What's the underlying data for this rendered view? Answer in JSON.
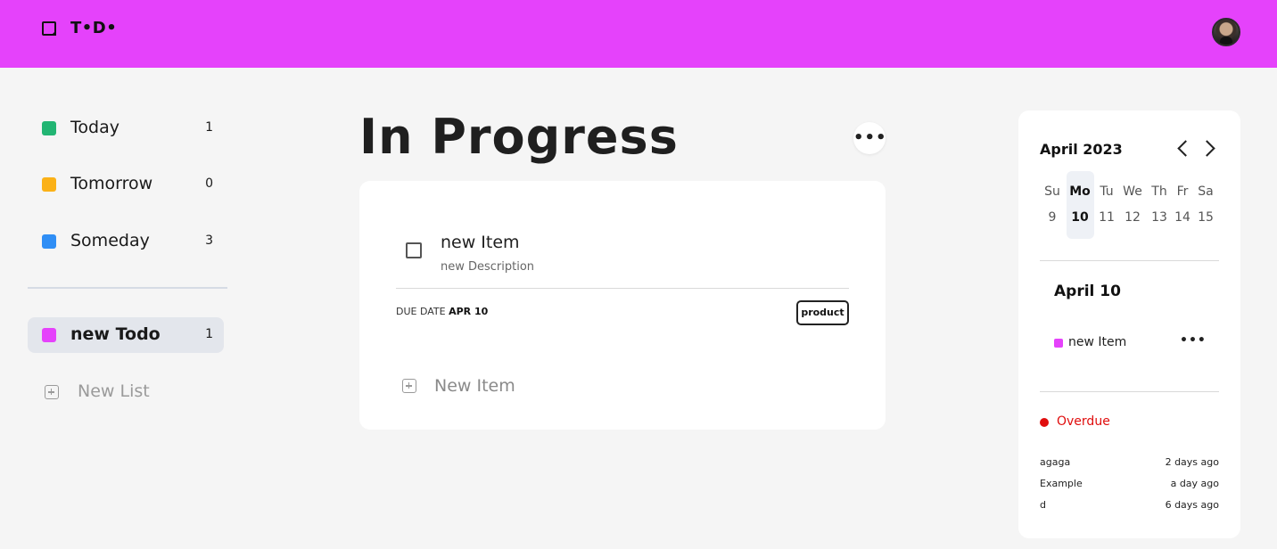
{
  "app": {
    "logo_text": "T•D•"
  },
  "colors": {
    "brand": "#e542fb",
    "today": "#22b573",
    "tomorrow": "#fbb117",
    "someday": "#2f8ef5",
    "new_todo": "#e542fb",
    "overdue": "#e00d0d"
  },
  "sidebar": {
    "items": [
      {
        "label": "Today",
        "count": "1"
      },
      {
        "label": "Tomorrow",
        "count": "0"
      },
      {
        "label": "Someday",
        "count": "3"
      },
      {
        "label": "new Todo",
        "count": "1"
      }
    ],
    "new_list_label": "New List"
  },
  "main": {
    "title": "In Progress",
    "more_label": "•••",
    "item": {
      "title": "new Item",
      "description": "new Description",
      "due_prefix": "DUE DATE",
      "due_value": "APR 10",
      "tag": "product"
    },
    "new_item_label": "New Item"
  },
  "calendar": {
    "month": "April 2023",
    "weekdays": [
      "Su",
      "Mo",
      "Tu",
      "We",
      "Th",
      "Fr",
      "Sa"
    ],
    "days": [
      "9",
      "10",
      "11",
      "12",
      "13",
      "14",
      "15"
    ],
    "selected_date": "April 10",
    "event": {
      "label": "new Item",
      "more": "•••"
    },
    "overdue_label": "Overdue",
    "overdue_items": [
      {
        "name": "agaga",
        "ago": "2 days ago"
      },
      {
        "name": "Example",
        "ago": "a day ago"
      },
      {
        "name": "d",
        "ago": "6 days ago"
      }
    ]
  }
}
